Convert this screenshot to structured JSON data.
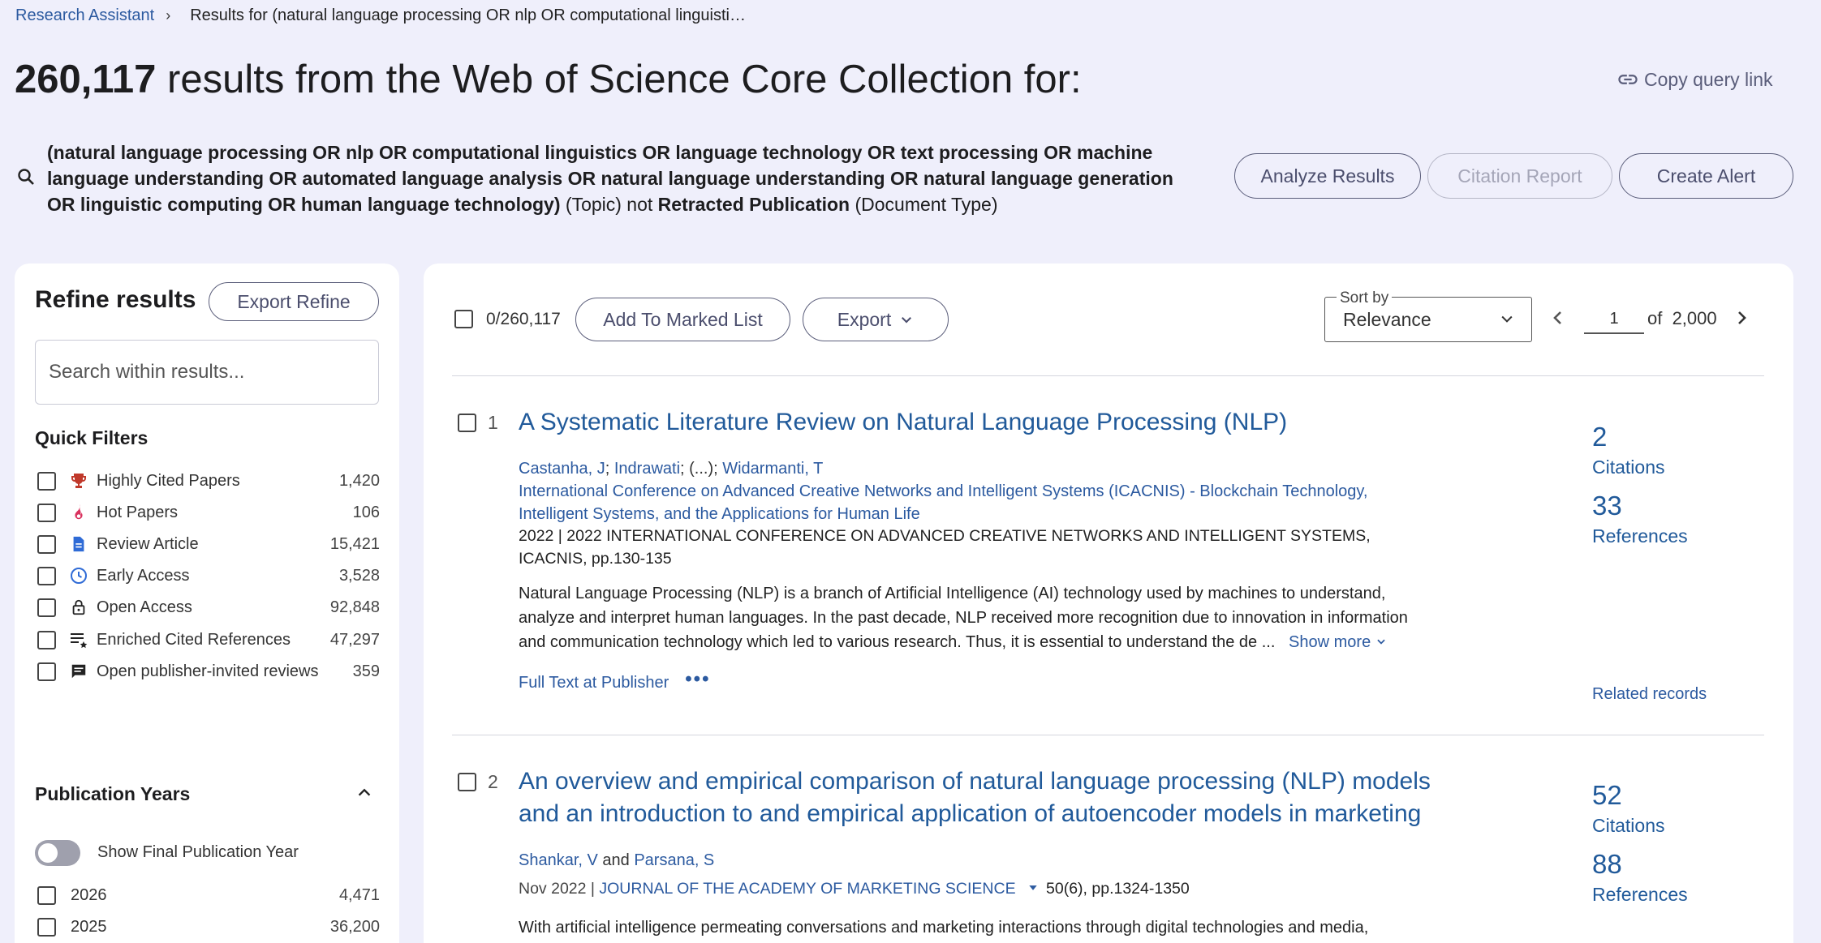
{
  "breadcrumb": {
    "home": "Research Assistant",
    "current": "Results for (natural language processing OR nlp OR computational linguisti…"
  },
  "header": {
    "count": "260,117",
    "title_rest": " results from the Web of Science Core Collection for:",
    "copy_link": "Copy query link"
  },
  "query": {
    "terms": "(natural language processing OR nlp OR computational linguistics OR language technology OR text processing OR machine language understanding OR automated language analysis OR natural language understanding OR natural language generation OR linguistic computing OR human language technology)",
    "field1": " (Topic) not ",
    "exclude": "Retracted Publication",
    "field2": " (Document Type)"
  },
  "actions": {
    "analyze": "Analyze Results",
    "citation_report": "Citation Report",
    "create_alert": "Create Alert"
  },
  "refine": {
    "title": "Refine results",
    "export_refine": "Export Refine",
    "search_placeholder": "Search within results...",
    "quick_filters_title": "Quick Filters",
    "quick_filters": [
      {
        "label": "Highly Cited Papers",
        "count": "1,420",
        "icon": "trophy-icon",
        "color": "#c0392b"
      },
      {
        "label": "Hot Papers",
        "count": "106",
        "icon": "flame-icon",
        "color": "#d9325e"
      },
      {
        "label": "Review Article",
        "count": "15,421",
        "icon": "document-icon",
        "color": "#2f6bd6"
      },
      {
        "label": "Early Access",
        "count": "3,528",
        "icon": "clock-icon",
        "color": "#2f6bd6"
      },
      {
        "label": "Open Access",
        "count": "92,848",
        "icon": "unlock-icon",
        "color": "#222222"
      },
      {
        "label": "Enriched Cited References",
        "count": "47,297",
        "icon": "list-star-icon",
        "color": "#222222"
      },
      {
        "label": "Open publisher-invited reviews",
        "count": "359",
        "icon": "comment-icon",
        "color": "#222222"
      }
    ],
    "pub_years_title": "Publication Years",
    "show_final_label": "Show Final Publication Year",
    "years": [
      {
        "label": "2026",
        "count": "4,471"
      },
      {
        "label": "2025",
        "count": "36,200"
      }
    ]
  },
  "toolbar": {
    "selected": "0/260,117",
    "add_marked": "Add To Marked List",
    "export": "Export",
    "sort_label": "Sort by",
    "sort_value": "Relevance",
    "page": "1",
    "of_pages": "of  2,000"
  },
  "records": [
    {
      "num": "1",
      "title": "A Systematic Literature Review on Natural Language Processing (NLP)",
      "author1": "Castanha, J",
      "author2": "Indrawati",
      "ellipsis": "; (...); ",
      "author3": "Widarmanti, T",
      "conference": "International Conference on Advanced Creative Networks and Intelligent Systems (ICACNIS) - Blockchain Technology, Intelligent Systems, and the Applications for Human Life",
      "pubinfo": "2022 | 2022 INTERNATIONAL CONFERENCE ON ADVANCED CREATIVE NETWORKS AND INTELLIGENT SYSTEMS, ICACNIS, pp.130-135",
      "abstract": "Natural Language Processing (NLP) is a branch of Artificial Intelligence (AI) technology used by machines to understand, analyze and interpret human languages. In the past decade, NLP received more recognition due to innovation in information and communication technology which led to various research. Thus, it is essential to understand the de ...",
      "show_more": "Show more",
      "full_text": "Full Text at Publisher",
      "citations": "2",
      "citations_label": "Citations",
      "references": "33",
      "references_label": "References",
      "related": "Related records"
    },
    {
      "num": "2",
      "title": "An overview and empirical comparison of natural language processing (NLP) models and an introduction to and empirical application of autoencoder models in marketing",
      "author1": "Shankar, V",
      "and": " and ",
      "author2": "Parsana, S",
      "date": "Nov 2022 | ",
      "journal": "JOURNAL OF THE ACADEMY OF MARKETING SCIENCE",
      "volume": "50(6), pp.1324-1350",
      "abstract": "With artificial intelligence permeating conversations and marketing interactions through digital technologies and media,",
      "citations": "52",
      "citations_label": "Citations",
      "references": "88",
      "references_label": "References"
    }
  ]
}
